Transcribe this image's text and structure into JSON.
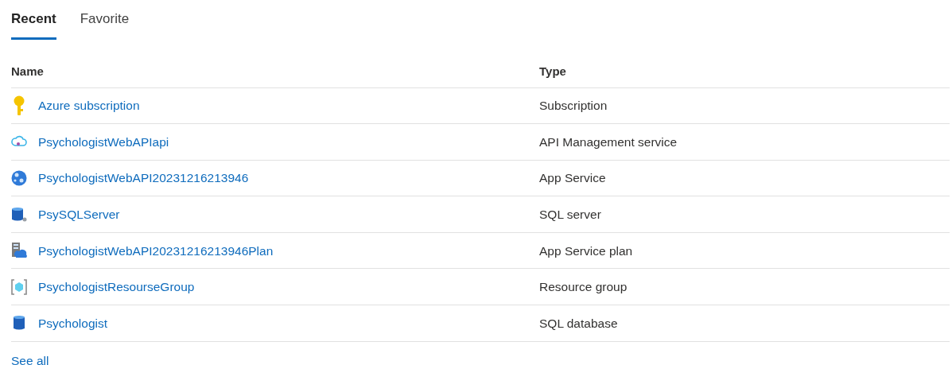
{
  "tabs": [
    {
      "label": "Recent",
      "selected": true
    },
    {
      "label": "Favorite",
      "selected": false
    }
  ],
  "table": {
    "columns": [
      "Name",
      "Type"
    ],
    "rows": [
      {
        "kind": "key",
        "name": "Azure subscription",
        "type": "Subscription"
      },
      {
        "kind": "api",
        "name": "PsychologistWebAPIapi",
        "type": "API Management service"
      },
      {
        "kind": "appservice",
        "name": "PsychologistWebAPI20231216213946",
        "type": "App Service"
      },
      {
        "kind": "sqlserver",
        "name": "PsySQLServer",
        "type": "SQL server"
      },
      {
        "kind": "plan",
        "name": "PsychologistWebAPI20231216213946Plan",
        "type": "App Service plan"
      },
      {
        "kind": "resourcegroup",
        "name": "PsychologistResourseGroup",
        "type": "Resource group"
      },
      {
        "kind": "sqldb",
        "name": "Psychologist",
        "type": "SQL database"
      }
    ]
  },
  "see_all": "See all"
}
